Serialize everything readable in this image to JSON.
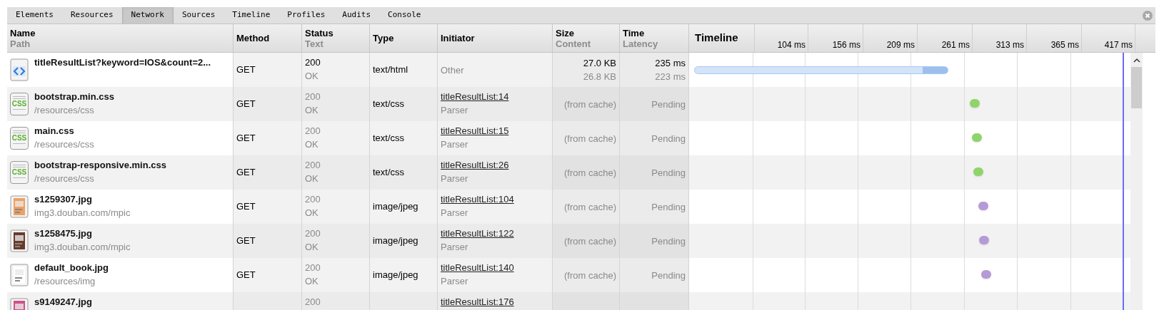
{
  "tabs": [
    {
      "label": "Elements",
      "selected": false
    },
    {
      "label": "Resources",
      "selected": false
    },
    {
      "label": "Network",
      "selected": true
    },
    {
      "label": "Sources",
      "selected": false
    },
    {
      "label": "Timeline",
      "selected": false
    },
    {
      "label": "Profiles",
      "selected": false
    },
    {
      "label": "Audits",
      "selected": false
    },
    {
      "label": "Console",
      "selected": false
    }
  ],
  "columns": [
    {
      "title": "Name",
      "subtitle": "Path"
    },
    {
      "title": "Method"
    },
    {
      "title": "Status",
      "subtitle": "Text"
    },
    {
      "title": "Type"
    },
    {
      "title": "Initiator"
    },
    {
      "title": "Size",
      "subtitle": "Content"
    },
    {
      "title": "Time",
      "subtitle": "Latency"
    },
    {
      "title": "Timeline"
    }
  ],
  "ticks": [
    "104 ms",
    "156 ms",
    "209 ms",
    "261 ms",
    "313 ms",
    "365 ms",
    "417 ms"
  ],
  "rows": [
    {
      "kind": "html",
      "name": "titleResultList?keyword=IOS&count=2...",
      "method": "GET",
      "status": "200",
      "status_text": "OK",
      "cached": false,
      "type": "text/html",
      "initiator_type": "Other",
      "size": "27.0 KB",
      "content": "26.8 KB",
      "time": "235 ms",
      "latency": "223 ms",
      "color": "#9cc0ee"
    },
    {
      "kind": "css",
      "icon_text": "CSS",
      "name": "bootstrap.min.css",
      "path": "/resources/css",
      "method": "GET",
      "status": "200",
      "status_text": "OK",
      "cached": true,
      "type": "text/css",
      "initiator_link": "titleResultList:14",
      "initiator_type": "Parser",
      "size": "(from cache)",
      "time": "Pending",
      "level": 0.641,
      "color": "#8fd46a"
    },
    {
      "kind": "css",
      "icon_text": "CSS",
      "name": "main.css",
      "path": "/resources/css",
      "method": "GET",
      "status": "200",
      "status_text": "OK",
      "cached": true,
      "type": "text/css",
      "initiator_link": "titleResultList:15",
      "initiator_type": "Parser",
      "size": "(from cache)",
      "time": "Pending",
      "level": 0.646,
      "color": "#8fd46a"
    },
    {
      "kind": "css",
      "icon_text": "CSS",
      "name": "bootstrap-responsive.min.css",
      "path": "/resources/css",
      "method": "GET",
      "status": "200",
      "status_text": "OK",
      "cached": true,
      "type": "text/css",
      "initiator_link": "titleResultList:26",
      "initiator_type": "Parser",
      "size": "(from cache)",
      "time": "Pending",
      "level": 0.649,
      "color": "#8fd46a"
    },
    {
      "name": "s1259307.jpg",
      "path": "img3.douban.com/mpic",
      "method": "GET",
      "status": "200",
      "status_text": "OK",
      "cached": true,
      "type": "image/jpeg",
      "initiator_link": "titleResultList:104",
      "initiator_type": "Parser",
      "size": "(from cache)",
      "time": "Pending",
      "level": 0.66,
      "color": "#b59ad8"
    },
    {
      "name": "s1258475.jpg",
      "path": "img3.douban.com/mpic",
      "method": "GET",
      "status": "200",
      "status_text": "OK",
      "cached": true,
      "type": "image/jpeg",
      "initiator_link": "titleResultList:122",
      "initiator_type": "Parser",
      "size": "(from cache)",
      "time": "Pending",
      "level": 0.662,
      "color": "#b59ad8"
    },
    {
      "name": "default_book.jpg",
      "path": "/resources/img",
      "method": "GET",
      "status": "200",
      "status_text": "OK",
      "cached": true,
      "type": "image/jpeg",
      "initiator_link": "titleResultList:140",
      "initiator_type": "Parser",
      "size": "(from cache)",
      "time": "Pending",
      "level": 0.667,
      "color": "#b59ad8"
    },
    {
      "name": "s9149247.jpg",
      "status": "200",
      "cached": true,
      "initiator_link": "titleResultList:176"
    }
  ]
}
